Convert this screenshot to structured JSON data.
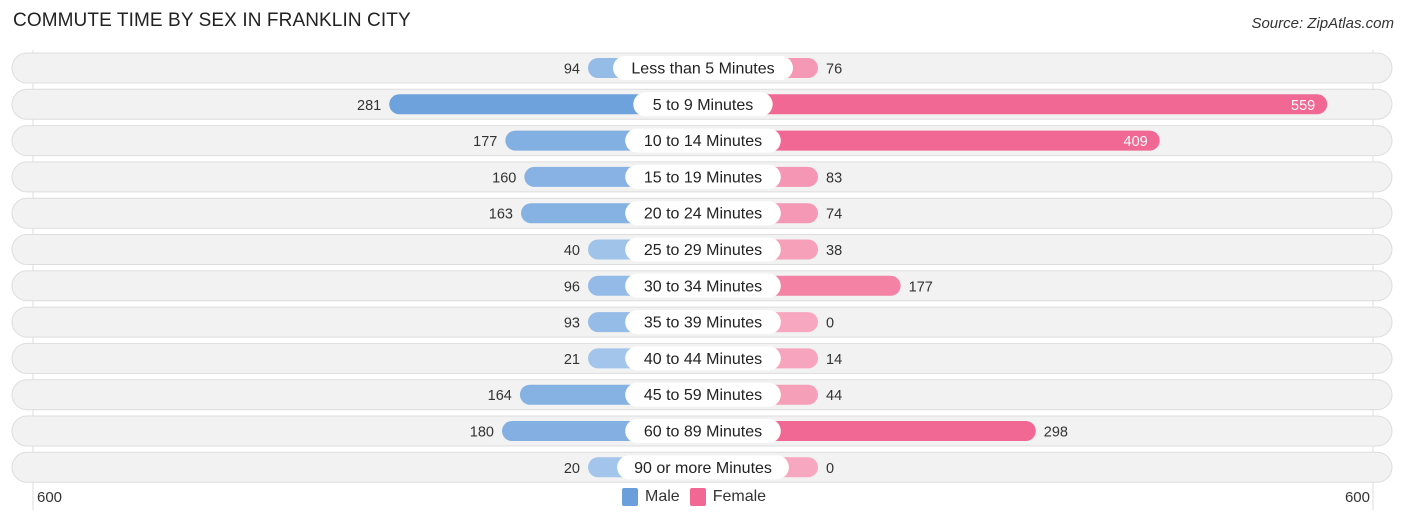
{
  "header": {
    "title": "COMMUTE TIME BY SEX IN FRANKLIN CITY",
    "source": "Source: ZipAtlas.com"
  },
  "colors": {
    "male_strong": "#6a9fdc",
    "male_light": "#a8c8ec",
    "female_strong": "#f06893",
    "female_light": "#f7a8c0",
    "row_bg": "#f2f2f2",
    "row_border": "#dddddd"
  },
  "legend": [
    {
      "label": "Male",
      "color": "#6a9fdc"
    },
    {
      "label": "Female",
      "color": "#f06893"
    }
  ],
  "axis": {
    "left_label": "600",
    "right_label": "600"
  },
  "chart_data": {
    "type": "bar",
    "orientation": "horizontal-diverging",
    "title": "COMMUTE TIME BY SEX IN FRANKLIN CITY",
    "xlabel": "",
    "ylabel": "",
    "xlim": [
      -600,
      600
    ],
    "categories": [
      "Less than 5 Minutes",
      "5 to 9 Minutes",
      "10 to 14 Minutes",
      "15 to 19 Minutes",
      "20 to 24 Minutes",
      "25 to 29 Minutes",
      "30 to 34 Minutes",
      "35 to 39 Minutes",
      "40 to 44 Minutes",
      "45 to 59 Minutes",
      "60 to 89 Minutes",
      "90 or more Minutes"
    ],
    "series": [
      {
        "name": "Male",
        "values": [
          94,
          281,
          177,
          160,
          163,
          40,
          96,
          93,
          21,
          164,
          180,
          20
        ]
      },
      {
        "name": "Female",
        "values": [
          76,
          559,
          409,
          83,
          74,
          38,
          177,
          0,
          14,
          44,
          298,
          0
        ]
      }
    ],
    "legend_position": "bottom-center",
    "grid": false
  }
}
